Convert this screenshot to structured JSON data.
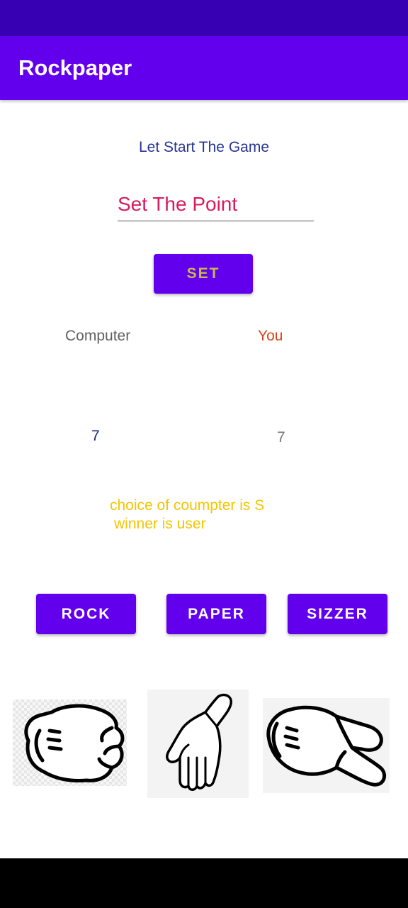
{
  "app": {
    "title": "Rockpaper"
  },
  "game": {
    "subtitle": "Let Start The Game",
    "point_placeholder": "Set The Point",
    "set_label": "SET",
    "computer_label": "Computer",
    "you_label": "You",
    "computer_score": "7",
    "you_score": "7",
    "choice_text": "choice of coumpter is S",
    "winner_text": "winner is user"
  },
  "choices": {
    "rock_label": "ROCK",
    "paper_label": "PAPER",
    "sizzer_label": "SIZZER"
  },
  "colors": {
    "status_bar": "#3700b3",
    "app_bar": "#6200ee",
    "button": "#6200ee",
    "result_text": "#f5c400",
    "input_text": "#d81b60"
  },
  "icons": [
    "rock-hand-icon",
    "paper-hand-icon",
    "scissors-hand-icon"
  ]
}
